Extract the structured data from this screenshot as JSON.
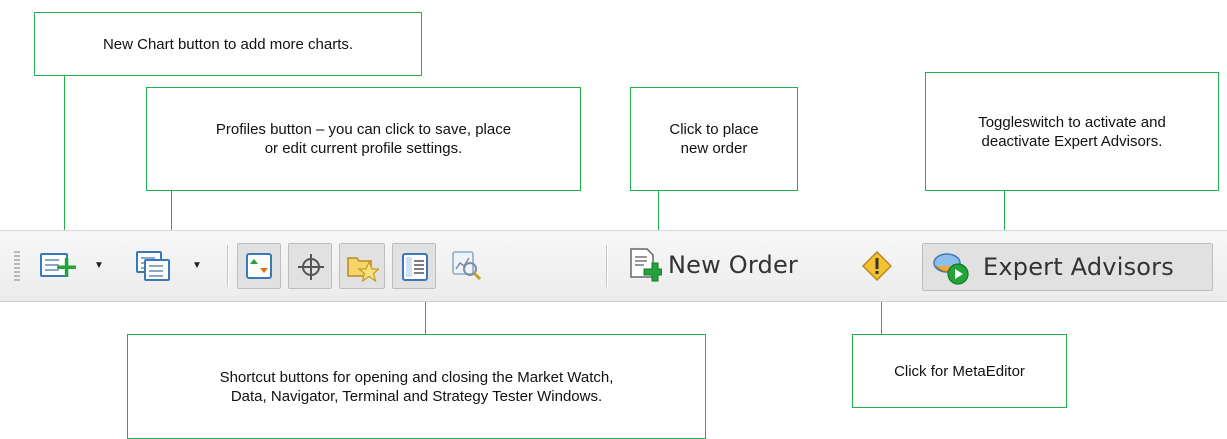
{
  "callouts": {
    "new_chart": "New Chart button to add more charts.",
    "profiles": "Profiles button – you can click to save, place\nor edit current profile settings.",
    "new_order": "Click to place\nnew order",
    "expert_advisors": "Toggleswitch to activate and\ndeactivate Expert Advisors.",
    "shortcuts": "Shortcut buttons for opening and closing the Market Watch,\nData, Navigator, Terminal and Strategy Tester Windows.",
    "metaeditor": "Click for MetaEditor"
  },
  "toolbar": {
    "new_order_label": "New Order",
    "expert_advisors_label": "Expert Advisors"
  },
  "icons": {
    "new_chart": "new-chart-icon",
    "profiles": "profiles-icon",
    "market_watch": "market-watch-icon",
    "data_window": "crosshair-icon",
    "navigator": "navigator-icon",
    "terminal": "terminal-icon",
    "strategy_tester": "strategy-tester-icon",
    "new_order": "new-order-icon",
    "metaeditor": "metaeditor-icon",
    "expert_advisors": "expert-advisors-icon"
  },
  "colors": {
    "callout_border": "#21b04b",
    "plus_green": "#23a338"
  }
}
